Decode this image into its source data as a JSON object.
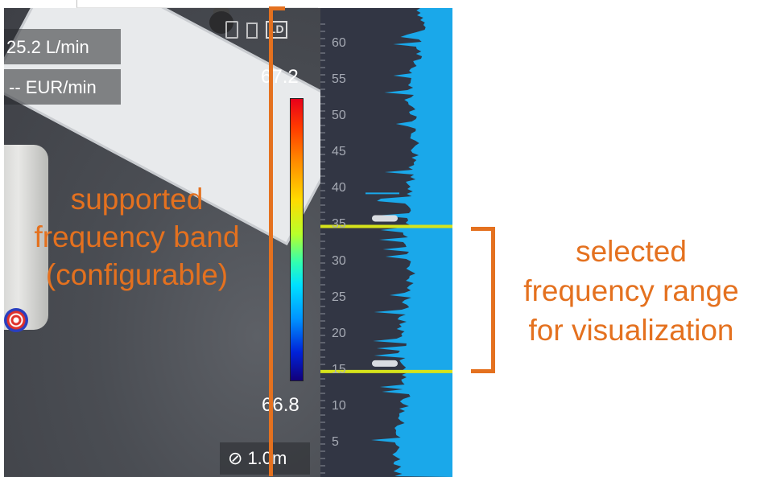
{
  "camera": {
    "flow_rate": "25.2 L/min",
    "cost_rate": "-- EUR/min",
    "status": {
      "ld_badge": "LD",
      "icons": [
        "sd-card-icon",
        "battery-icon"
      ]
    },
    "scale_max": "67.2",
    "scale_min": "66.8",
    "distance": "1.0m",
    "distance_icon": "measure-icon"
  },
  "spectrum": {
    "axis_labels": [
      "60",
      "55",
      "50",
      "45",
      "40",
      "35",
      "30",
      "25",
      "20",
      "15",
      "10",
      "5"
    ],
    "selection_upper": 35,
    "selection_lower": 15,
    "colors": {
      "background": "#323644",
      "fill": "#1aa8ea",
      "selection_line": "#d6e31b"
    }
  },
  "annotations": {
    "band_lines": [
      "supported",
      "frequency band",
      "(configurable)"
    ],
    "range_lines": [
      "selected",
      "frequency range",
      "for visualization"
    ],
    "color": "#e4711f"
  }
}
